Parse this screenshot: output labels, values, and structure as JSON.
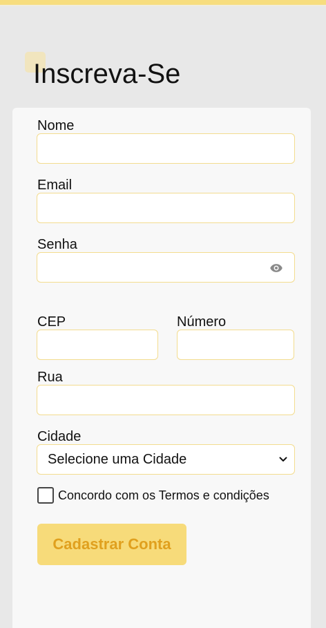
{
  "header": {
    "title": "Inscreva-Se"
  },
  "form": {
    "nome_label": "Nome",
    "nome_value": "",
    "email_label": "Email",
    "email_value": "",
    "senha_label": "Senha",
    "senha_value": "",
    "cep_label": "CEP",
    "cep_value": "",
    "numero_label": "Número",
    "numero_value": "",
    "rua_label": "Rua",
    "rua_value": "",
    "cidade_label": "Cidade",
    "cidade_selected": "Selecione uma Cidade",
    "terms_label": "Concordo com os Termos e condições",
    "terms_checked": false,
    "submit_label": "Cadastrar Conta"
  },
  "colors": {
    "accent": "#f7db7a",
    "accent_text": "#e0a01e",
    "field_border": "#f3dc8e",
    "card_bg": "#f8f8f8",
    "page_bg": "#e8e8e8"
  },
  "icons": {
    "password_toggle": "eye-icon",
    "select_arrow": "chevron-down-icon"
  }
}
